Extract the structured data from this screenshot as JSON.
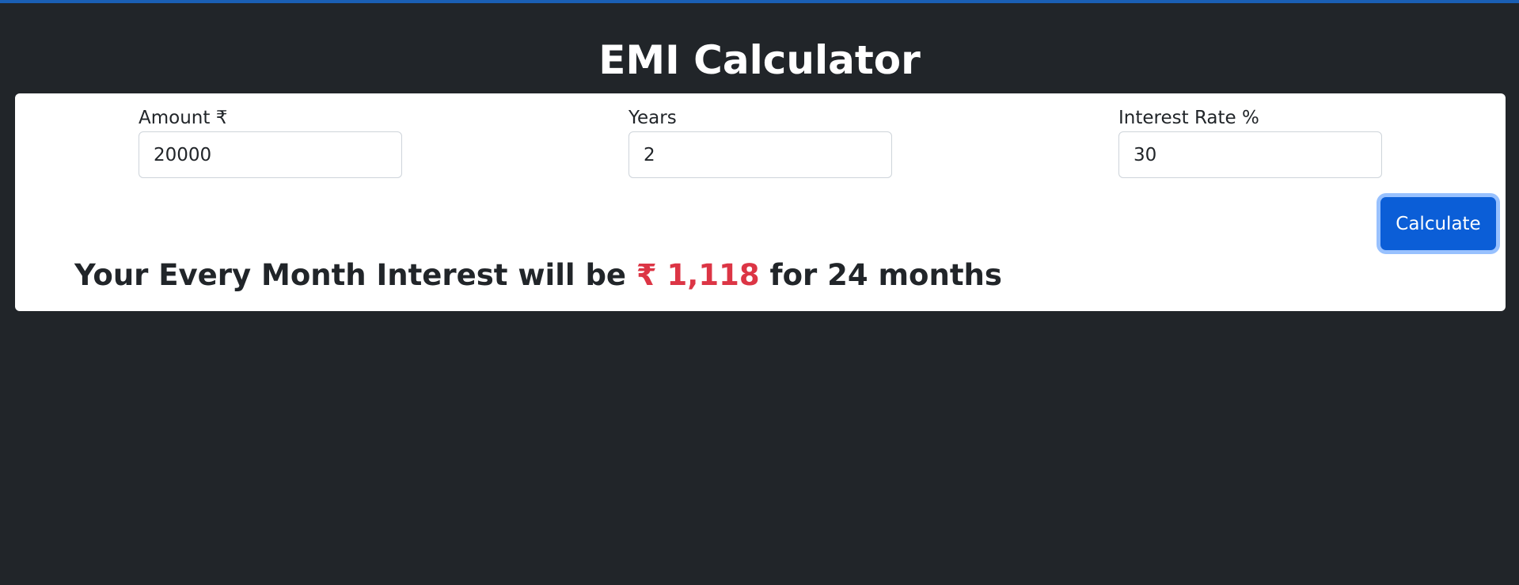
{
  "header": {
    "title": "EMI Calculator",
    "accent_color": "#1a5fb4"
  },
  "form": {
    "amount": {
      "label": "Amount ₹",
      "value": "20000"
    },
    "years": {
      "label": "Years",
      "value": "2"
    },
    "rate": {
      "label": "Interest Rate %",
      "value": "30"
    },
    "calculate_label": "Calculate"
  },
  "result": {
    "prefix": "Your Every Month Interest will be",
    "emi": "₹ 1,118",
    "suffix": "for 24 months",
    "emi_color": "#dc3545"
  },
  "colors": {
    "background": "#212529",
    "card": "#ffffff",
    "button": "#0b5ed7"
  }
}
